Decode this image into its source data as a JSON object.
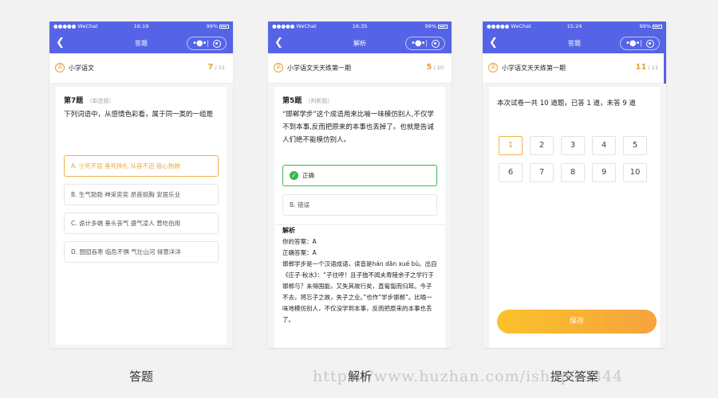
{
  "phones": [
    {
      "status": {
        "carrier": "●●●●● WeChat",
        "time": "16:19",
        "battery": "99%"
      },
      "nav_title": "答题",
      "header": {
        "name": "小学语文",
        "current": "7",
        "total": "/ 11"
      },
      "question": {
        "number": "第7题",
        "type": "（单选题）",
        "text": "下列词语中，从感情色彩看，属于同一类的一组是",
        "options": [
          "A. 宁死不屈 垂死挣扎 从容不迫 狼心狗肺",
          "B. 生气勃勃 神采奕奕 昂首挺胸 安居乐业",
          "C. 诡计多端 垂头丧气 盛气凌人 曾吃伯用",
          "D. 囫囵吞枣 临危不惧 气壮山河 得意洋洋"
        ]
      }
    },
    {
      "status": {
        "carrier": "●●●●● WeChat",
        "time": "16:35",
        "battery": "99%"
      },
      "nav_title": "解析",
      "header": {
        "name": "小学语文天天练第一期",
        "current": "5",
        "total": "/ 10"
      },
      "question": {
        "number": "第5题",
        "type": "（判断题）",
        "text": "“邯郸学步”这个成语用来比喻一味模仿别人,不仅学不到本事,反而把原来的本事也丢掉了。也就是告诫人们绝不能模仿别人。",
        "options": [
          "正确",
          "B. 错误"
        ]
      },
      "analysis": {
        "heading": "解析",
        "your_answer": "你的答案：A",
        "correct_answer": "正确答案：A",
        "body": "邯郸学步是一个汉语成语，读音是hán dān xué bù。出自《庄子·秋水》：“子往呼！且子独不闻夫寿陵余子之学行于邯郸与？未得国能，又失其故行矣，直匍匐而归耳。今子不去，将忘子之故，失子之业。”也作“学步邯郸”。比喻一味地模仿别人，不仅没学到本事，反而把原来的本事也丢了。"
      }
    },
    {
      "status": {
        "carrier": "●●●●● WeChat",
        "time": "15:24",
        "battery": "99%"
      },
      "nav_title": "答题",
      "header": {
        "name": "小学语文天天练第一期",
        "current": "11",
        "total": "/ 11"
      },
      "summary": "本次试卷一共 10 道题，已答 1 道，未答 9 道",
      "numbers": [
        "1",
        "2",
        "3",
        "4",
        "5",
        "6",
        "7",
        "8",
        "9",
        "10"
      ],
      "save_label": "保存"
    }
  ],
  "captions": [
    "答题",
    "解析",
    "提交答案"
  ],
  "watermark": "https://www.huzhan.com/ishop30344",
  "colors": {
    "nav": "#5564e6",
    "accent": "#f0b24a",
    "correct": "#3bb54a"
  },
  "icons": {
    "back": "chevron-left-icon",
    "more": "more-dots-icon",
    "close": "target-circle-icon",
    "logo": "brand-circle-icon",
    "check": "check-circle-icon"
  }
}
